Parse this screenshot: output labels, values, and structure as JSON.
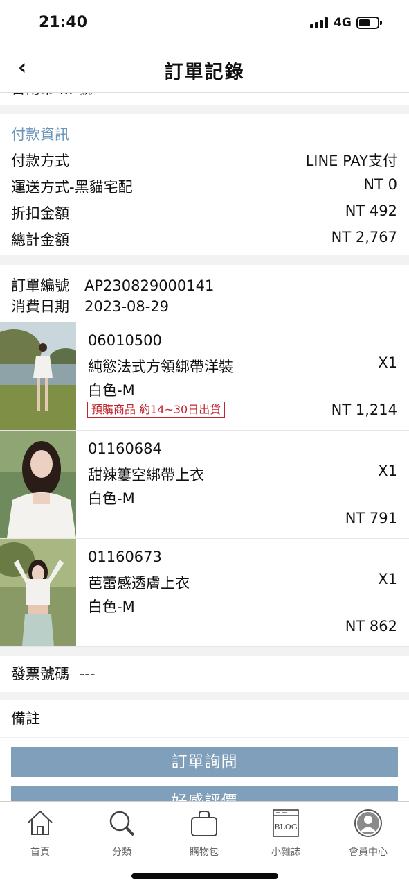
{
  "status": {
    "time": "21:40",
    "network": "4G"
  },
  "nav": {
    "title": "訂單記錄"
  },
  "address_cut": "台南市 ... 號",
  "payment": {
    "heading": "付款資訊",
    "rows": [
      {
        "label": "付款方式",
        "value": "LINE PAY支付"
      },
      {
        "label": "運送方式-黑貓宅配",
        "value": "NT 0"
      },
      {
        "label": "折扣金額",
        "value": "NT 492"
      },
      {
        "label": "總計金額",
        "value": "NT 2,767"
      }
    ]
  },
  "order": {
    "number_label": "訂單編號",
    "number": "AP230829000141",
    "date_label": "消費日期",
    "date": "2023-08-29"
  },
  "products": [
    {
      "code": "06010500",
      "name": "純慾法式方領綁帶洋裝",
      "variant": "白色-M",
      "qty": "X1",
      "price": "NT 1,214",
      "tag": "預購商品 約14~30日出貨"
    },
    {
      "code": "01160684",
      "name": "甜辣簍空綁帶上衣",
      "variant": "白色-M",
      "qty": "X1",
      "price": "NT 791"
    },
    {
      "code": "01160673",
      "name": "芭蕾感透膚上衣",
      "variant": "白色-M",
      "qty": "X1",
      "price": "NT 862"
    }
  ],
  "invoice": {
    "label": "發票號碼",
    "value": "---"
  },
  "note": {
    "label": "備註"
  },
  "buttons": {
    "inquiry": "訂單詢問",
    "review": "好感評價"
  },
  "tabs": [
    {
      "label": "首頁",
      "icon": "home-icon"
    },
    {
      "label": "分類",
      "icon": "search-icon"
    },
    {
      "label": "購物包",
      "icon": "bag-icon"
    },
    {
      "label": "小雜誌",
      "icon": "blog-icon",
      "icon_text": "BLOG"
    },
    {
      "label": "會員中心",
      "icon": "member-icon"
    }
  ],
  "colors": {
    "accent": "#6b94b9",
    "button": "#7f9fba",
    "preorder": "#c0262d"
  }
}
